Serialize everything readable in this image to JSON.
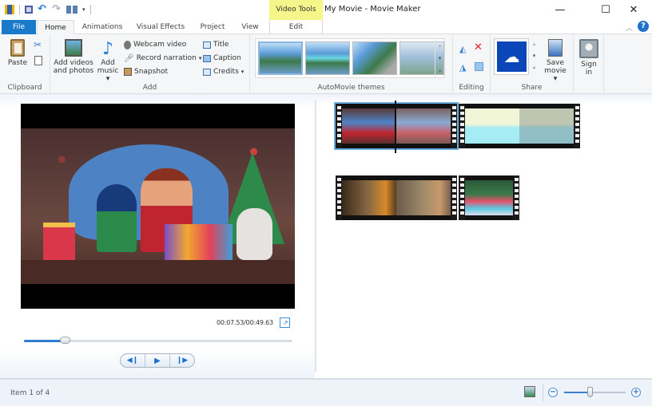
{
  "window": {
    "title": "My Movie - Movie Maker",
    "context_tab_group": "Video Tools",
    "controls": {
      "minimize": "—",
      "maximize": "☐",
      "close": "✕"
    }
  },
  "qat": {
    "icons": [
      "app-film-icon",
      "save-icon",
      "undo-icon",
      "redo-icon",
      "aspect-ratio-icon",
      "customize-qat-icon"
    ]
  },
  "tabs": [
    {
      "label": "File",
      "active": false
    },
    {
      "label": "Home",
      "active": true
    },
    {
      "label": "Animations",
      "active": false
    },
    {
      "label": "Visual Effects",
      "active": false
    },
    {
      "label": "Project",
      "active": false
    },
    {
      "label": "View",
      "active": false
    },
    {
      "label": "Edit",
      "active": false,
      "context": true
    }
  ],
  "ribbon": {
    "clipboard": {
      "label": "Clipboard",
      "paste": "Paste",
      "cut_icon": "scissors-icon",
      "copy_icon": "copy-icon"
    },
    "add": {
      "label": "Add",
      "add_videos_line1": "Add videos",
      "add_videos_line2": "and photos",
      "add_music_line1": "Add",
      "add_music_line2": "music",
      "webcam": "Webcam video",
      "narration": "Record narration",
      "snapshot": "Snapshot",
      "title": "Title",
      "caption": "Caption",
      "credits": "Credits"
    },
    "themes": {
      "label": "AutoMovie themes",
      "items": [
        "theme-default",
        "theme-contemporary",
        "theme-cinematic",
        "theme-fade"
      ],
      "selected": 0
    },
    "editing": {
      "label": "Editing",
      "icons": [
        "rotate-left-icon",
        "remove-icon",
        "rotate-right-icon",
        "select-all-icon"
      ]
    },
    "share": {
      "label": "Share",
      "service": "onedrive",
      "save_movie_line1": "Save",
      "save_movie_line2": "movie"
    },
    "signin": {
      "line1": "Sign",
      "line2": "in"
    }
  },
  "preview": {
    "time": "00:07.53/00:49.63",
    "progress": 0.1517,
    "buttons": [
      "previous-frame",
      "play",
      "next-frame"
    ]
  },
  "storyboard": {
    "clips": [
      {
        "name": "christmas-family",
        "selected": true
      },
      {
        "name": "snowmen-village",
        "selected": false
      },
      {
        "name": "fireplace-room",
        "selected": false
      },
      {
        "name": "christmas-stockings",
        "selected": false
      }
    ]
  },
  "status": {
    "item_text": "Item 1 of 4",
    "zoom_level": 0.42
  },
  "colors": {
    "file_tab": "#1979ca",
    "context_tab": "#f5f58a",
    "accent": "#2f7bd1"
  }
}
